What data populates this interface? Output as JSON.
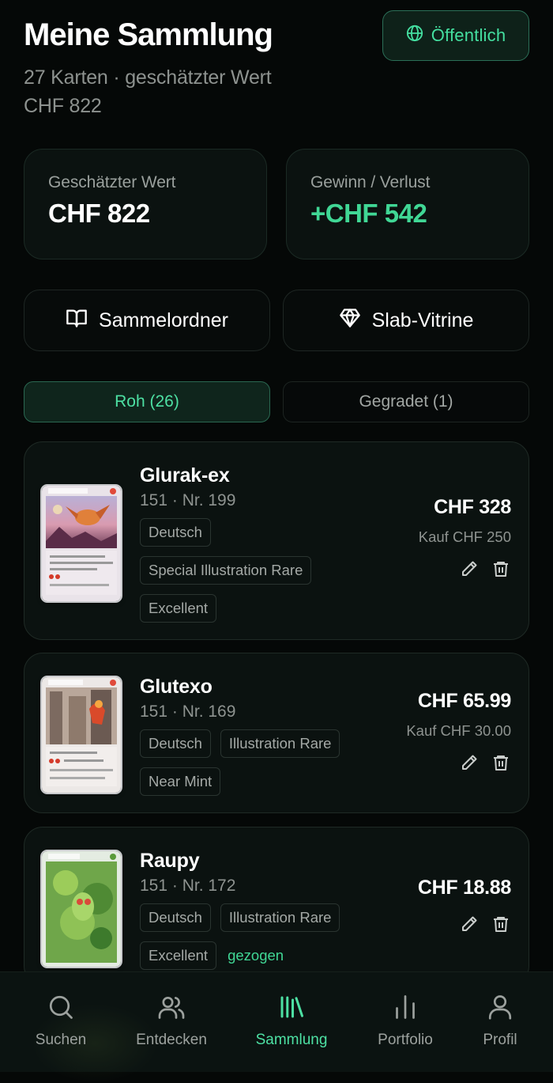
{
  "header": {
    "title": "Meine Sammlung",
    "subtitle_line1": "27 Karten · geschätzter Wert",
    "subtitle_line2": "CHF 822",
    "public_label": "Öffentlich"
  },
  "stats": {
    "estimated_label": "Geschätzter Wert",
    "estimated_value": "CHF 822",
    "profit_label": "Gewinn / Verlust",
    "profit_value": "+CHF 542"
  },
  "actions": {
    "binder_label": "Sammelordner",
    "slab_label": "Slab-Vitrine"
  },
  "tabs": {
    "raw_label": "Roh (26)",
    "graded_label": "Gegradet (1)"
  },
  "cards": [
    {
      "name": "Glurak-ex",
      "set": "151 · Nr. 199",
      "tags": [
        "Deutsch",
        "Special Illustration Rare",
        "Excellent"
      ],
      "price": "CHF 328",
      "purchase": "Kauf CHF 250"
    },
    {
      "name": "Glutexo",
      "set": "151 · Nr. 169",
      "tags": [
        "Deutsch",
        "Illustration Rare",
        "Near Mint"
      ],
      "price": "CHF 65.99",
      "purchase": "Kauf CHF 30.00"
    },
    {
      "name": "Raupy",
      "set": "151 · Nr. 172",
      "tags": [
        "Deutsch",
        "Illustration Rare",
        "Excellent"
      ],
      "extra": "gezogen",
      "price": "CHF 18.88"
    }
  ],
  "nav": {
    "search": "Suchen",
    "discover": "Entdecken",
    "collection": "Sammlung",
    "portfolio": "Portfolio",
    "profile": "Profil"
  },
  "colors": {
    "accent": "#44DFA0",
    "background": "#050807",
    "card": "#0B1210"
  },
  "icons": [
    "globe-icon",
    "book-icon",
    "diamond-icon",
    "pencil-icon",
    "trash-icon",
    "search-icon",
    "users-icon",
    "library-icon",
    "bar-chart-icon",
    "user-icon"
  ]
}
